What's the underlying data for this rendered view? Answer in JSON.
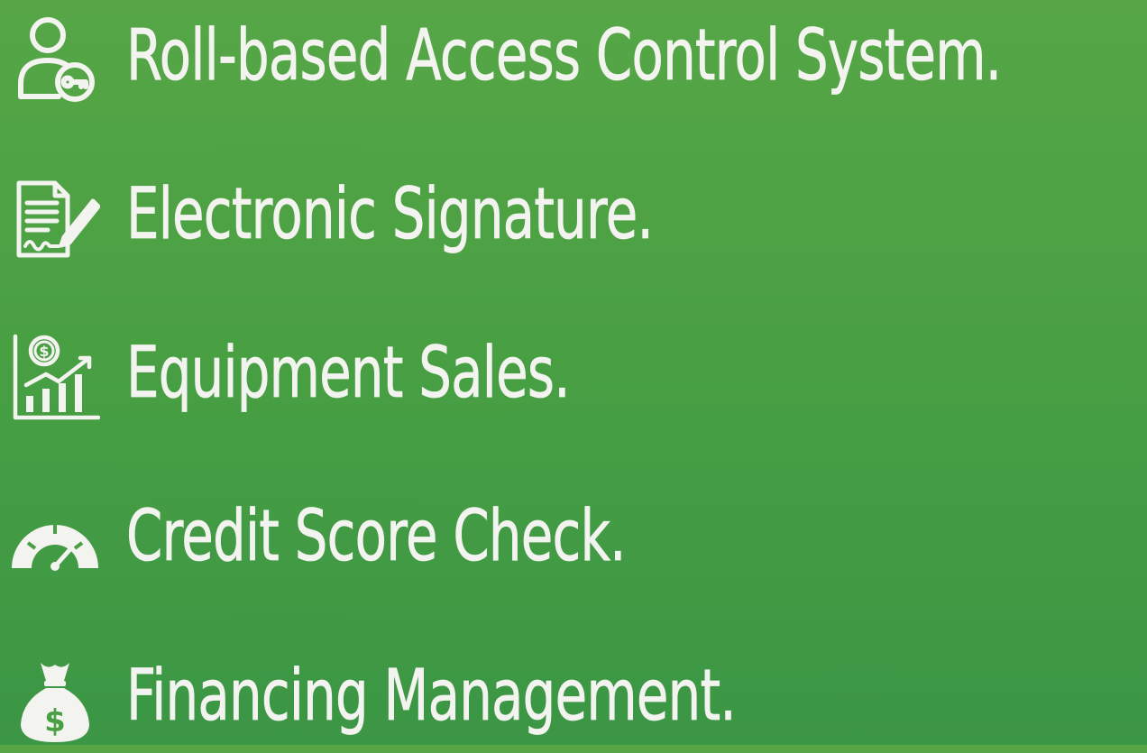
{
  "colors": {
    "background_top": "#56a646",
    "background_bottom": "#3b9645",
    "text": "#f3f3f0",
    "icon_stroke": "#f3f3f0"
  },
  "features": [
    {
      "icon": "user-key-icon",
      "label": "Roll-based Access Control System."
    },
    {
      "icon": "signed-document-icon",
      "label": "Electronic Signature."
    },
    {
      "icon": "sales-chart-icon",
      "label": "Equipment Sales."
    },
    {
      "icon": "speedometer-gauge-icon",
      "label": "Credit Score Check."
    },
    {
      "icon": "money-bag-icon",
      "label": "Financing Management."
    }
  ]
}
